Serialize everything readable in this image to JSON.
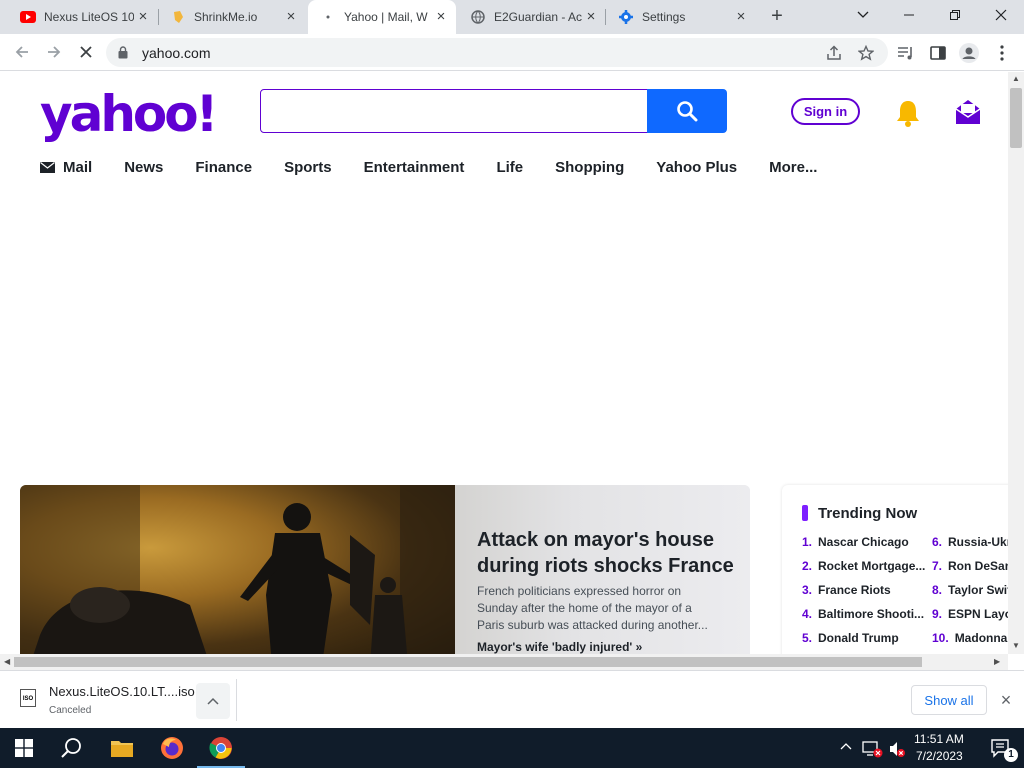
{
  "browser": {
    "tabs": [
      {
        "title": "Nexus LiteOS 10",
        "icon": "youtube-icon",
        "active": false
      },
      {
        "title": "ShrinkMe.io",
        "icon": "shrinkme-icon",
        "active": false
      },
      {
        "title": "Yahoo | Mail, W",
        "icon": "loading-icon",
        "active": true
      },
      {
        "title": "E2Guardian - Ac",
        "icon": "globe-icon",
        "active": false
      },
      {
        "title": "Settings",
        "icon": "gear-icon",
        "active": false
      }
    ],
    "url": "yahoo.com"
  },
  "yahoo": {
    "logo_text": "yahoo!",
    "search_placeholder": "",
    "signin_label": "Sign in",
    "nav": [
      "Mail",
      "News",
      "Finance",
      "Sports",
      "Entertainment",
      "Life",
      "Shopping",
      "Yahoo Plus",
      "More..."
    ],
    "hero": {
      "title": "Attack on mayor's house during riots shocks France",
      "summary": "French politicians expressed horror on Sunday after the home of the mayor of a Paris suburb was attacked during another...",
      "link": "Mayor's wife 'badly injured' »"
    },
    "trending": {
      "heading": "Trending Now",
      "items": [
        {
          "num": "1.",
          "label": "Nascar Chicago"
        },
        {
          "num": "2.",
          "label": "Rocket Mortgage..."
        },
        {
          "num": "3.",
          "label": "France Riots"
        },
        {
          "num": "4.",
          "label": "Baltimore Shooti..."
        },
        {
          "num": "5.",
          "label": "Donald Trump"
        },
        {
          "num": "6.",
          "label": "Russia-Ukr"
        },
        {
          "num": "7.",
          "label": "Ron DeSan"
        },
        {
          "num": "8.",
          "label": "Taylor Swif"
        },
        {
          "num": "9.",
          "label": "ESPN Layo"
        },
        {
          "num": "10.",
          "label": "Madonna"
        }
      ]
    },
    "colors": {
      "brand": "#6001d2",
      "search_button": "#0f69ff",
      "bell": "#f8b800"
    }
  },
  "downloads": {
    "file_name": "Nexus.LiteOS.10.LT....iso",
    "status": "Canceled",
    "file_badge": "ISO",
    "show_all_label": "Show all"
  },
  "taskbar": {
    "time": "11:51 AM",
    "date": "7/2/2023",
    "notification_count": "1"
  }
}
